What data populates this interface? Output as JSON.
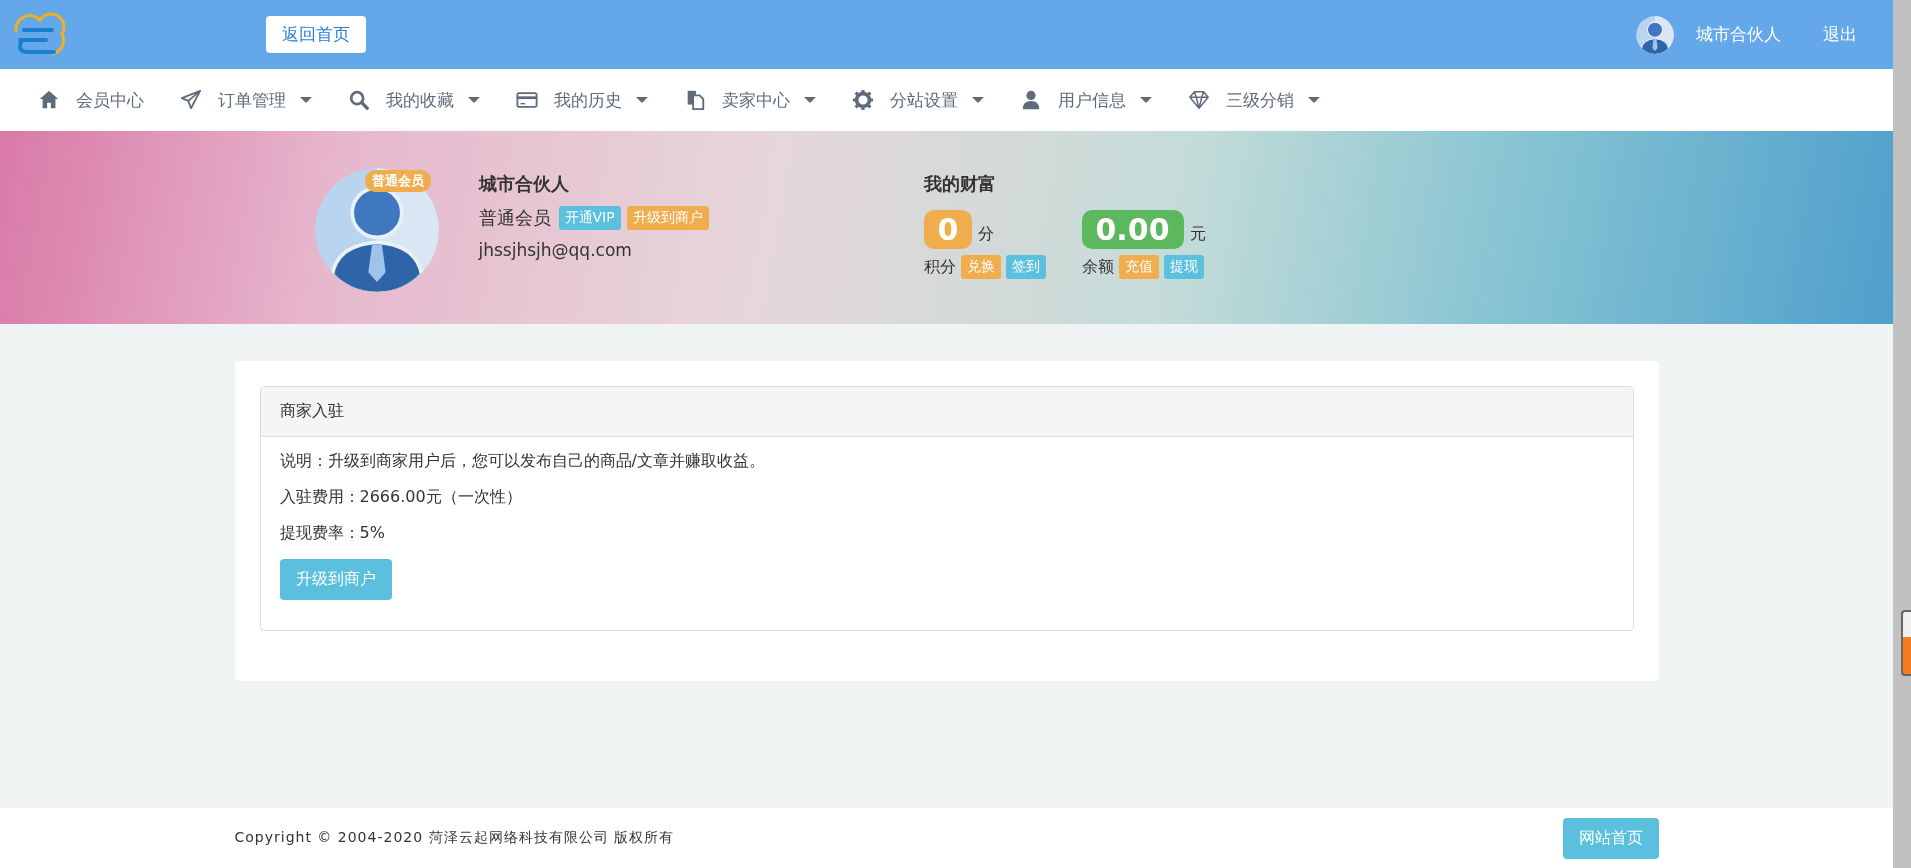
{
  "header": {
    "home_button": "返回首页",
    "user_name": "城市合伙人",
    "logout": "退出"
  },
  "nav": [
    {
      "label": "会员中心",
      "dropdown": false
    },
    {
      "label": "订单管理",
      "dropdown": true
    },
    {
      "label": "我的收藏",
      "dropdown": true
    },
    {
      "label": "我的历史",
      "dropdown": true
    },
    {
      "label": "卖家中心",
      "dropdown": true
    },
    {
      "label": "分站设置",
      "dropdown": true
    },
    {
      "label": "用户信息",
      "dropdown": true
    },
    {
      "label": "三级分销",
      "dropdown": true
    }
  ],
  "profile": {
    "badge": "普通会员",
    "name": "城市合伙人",
    "level": "普通会员",
    "tags": [
      {
        "label": "开通VIP",
        "color": "#5bc0de"
      },
      {
        "label": "升级到商户",
        "color": "#f0ad4e"
      }
    ],
    "email": "jhssjhsjh@qq.com"
  },
  "wealth": {
    "title": "我的财富",
    "accounts": [
      {
        "value": "0",
        "unit": "分",
        "color": "#f0ad4e",
        "label": "积分",
        "actions": [
          {
            "label": "兑换",
            "color": "#f0ad4e"
          },
          {
            "label": "签到",
            "color": "#5bc0de"
          }
        ]
      },
      {
        "value": "0.00",
        "unit": "元",
        "color": "#5cb85c",
        "label": "余额",
        "actions": [
          {
            "label": "充值",
            "color": "#f0ad4e"
          },
          {
            "label": "提现",
            "color": "#5bc0de"
          }
        ]
      }
    ]
  },
  "panel": {
    "title": "商家入驻",
    "lines": [
      "说明：升级到商家用户后，您可以发布自己的商品/文章并赚取收益。",
      "入驻费用：2666.00元（一次性）",
      "提现费率：5%"
    ],
    "button": "升级到商户"
  },
  "footer": {
    "copyright": "Copyright © 2004-2020 菏泽云起网络科技有限公司 版权所有",
    "button": "网站首页"
  }
}
